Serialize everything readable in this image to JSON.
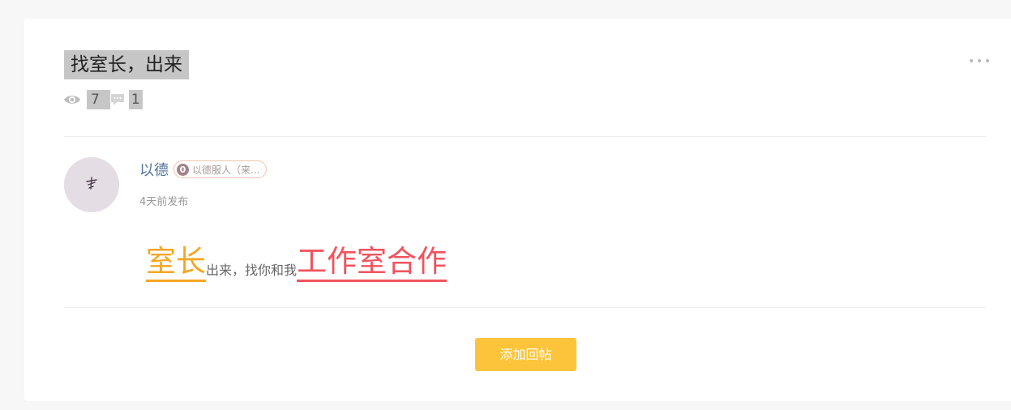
{
  "post": {
    "title": "找室长，出来",
    "views": "7",
    "comments": "1"
  },
  "author": {
    "name": "以德",
    "badge_level": "0",
    "badge_text": "以德服人（来...",
    "post_time": "4天前发布"
  },
  "content": {
    "part1": "室长",
    "part2": "出来，找你和我",
    "part3": "工作室合作"
  },
  "actions": {
    "reply_label": "添加回帖"
  },
  "colors": {
    "accent_orange": "#f6a623",
    "accent_red": "#f0545f",
    "button_yellow": "#fcc43a",
    "author_blue": "#52709a"
  },
  "icons": {
    "views": "eye-icon",
    "comments": "comment-icon",
    "more": "more-icon"
  }
}
